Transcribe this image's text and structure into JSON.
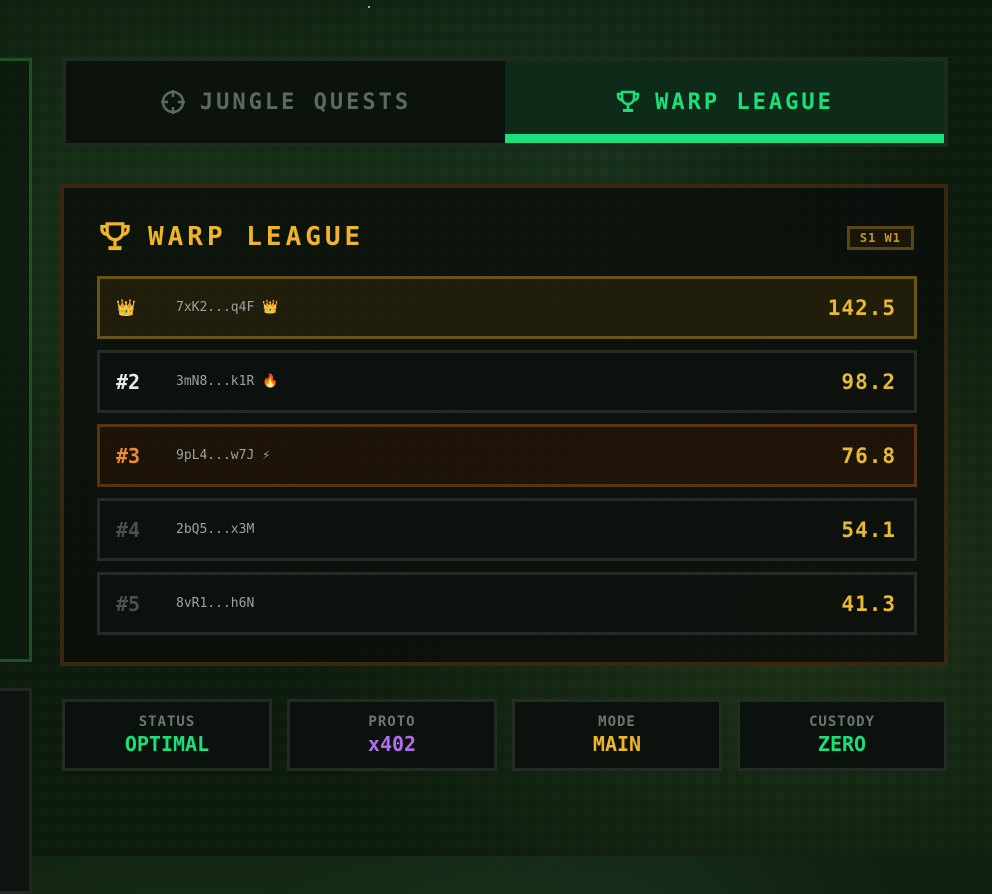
{
  "tabs": [
    {
      "label": "JUNGLE QUESTS",
      "icon": "crosshair-icon"
    },
    {
      "label": "WARP LEAGUE",
      "icon": "trophy-icon"
    }
  ],
  "league": {
    "title": "WARP LEAGUE",
    "season_badge": "S1 W1",
    "rows": [
      {
        "rank": "",
        "rank_icon": "👑",
        "wallet": "7xK2...q4F",
        "emblem": "👑",
        "score": "142.5"
      },
      {
        "rank": "#2",
        "wallet": "3mN8...k1R",
        "emblem": "🔥",
        "score": "98.2"
      },
      {
        "rank": "#3",
        "wallet": "9pL4...w7J",
        "emblem": "⚡",
        "score": "76.8"
      },
      {
        "rank": "#4",
        "wallet": "2bQ5...x3M",
        "emblem": "",
        "score": "54.1"
      },
      {
        "rank": "#5",
        "wallet": "8vR1...h6N",
        "emblem": "",
        "score": "41.3"
      }
    ]
  },
  "stats": [
    {
      "label": "STATUS",
      "value": "OPTIMAL",
      "color": "#19e07a"
    },
    {
      "label": "PROTO",
      "value": "x402",
      "color": "#b26cf0"
    },
    {
      "label": "MODE",
      "value": "MAIN",
      "color": "#f0b429"
    },
    {
      "label": "CUSTODY",
      "value": "ZERO",
      "color": "#19e07a"
    }
  ],
  "colors": {
    "accent_green": "#19e07a",
    "gold": "#f0b429",
    "rank2": "#e6ecea",
    "rank3": "#f08a2a",
    "rank_muted": "#4a524c"
  }
}
